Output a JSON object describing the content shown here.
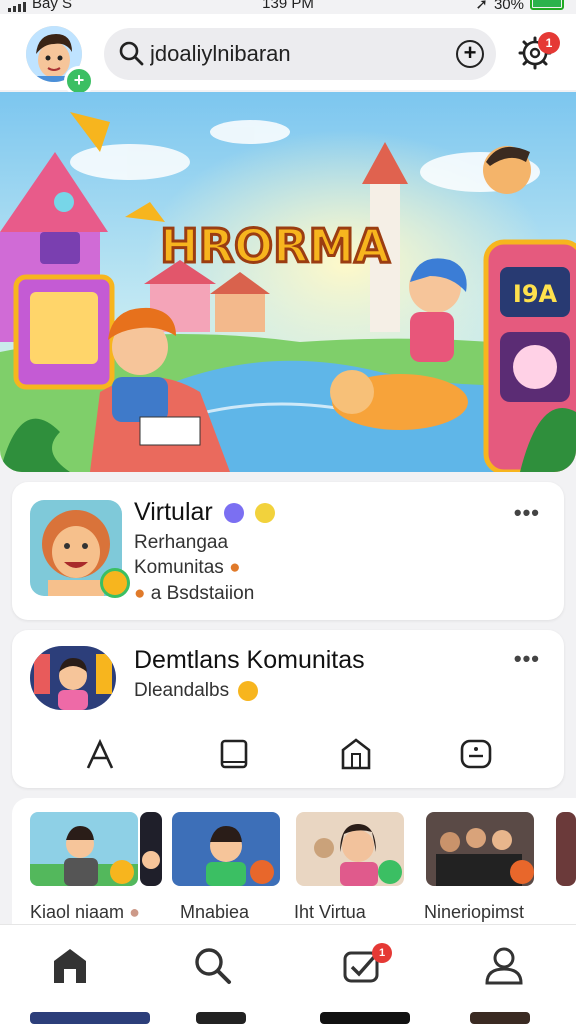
{
  "status": {
    "carrier": "Bay S",
    "time": "139 PM",
    "battery": "30%"
  },
  "header": {
    "search_value": "jdoaliylnibaran",
    "notification_count": "1"
  },
  "hero": {
    "title": "HRORMA",
    "sign": "I9A"
  },
  "card1": {
    "title": "Virtular",
    "line1": "Rerhangaa",
    "line2": "Komunitas",
    "line3": "a Bsdstaiion"
  },
  "card2": {
    "title": "Demtlans Komunitas",
    "subtitle": "Dleandalbs"
  },
  "strip": {
    "items": [
      {
        "label": "Kiaol niaam"
      },
      {
        "label": "Mnabiea"
      },
      {
        "label": "Iht Virtua"
      },
      {
        "label": "Nineriopimst"
      }
    ]
  },
  "bottom_nav": {
    "badge": "1"
  },
  "colors": {
    "accent_green": "#3bbf63",
    "badge_red": "#e53935",
    "hero_title": "#f7b51e"
  }
}
